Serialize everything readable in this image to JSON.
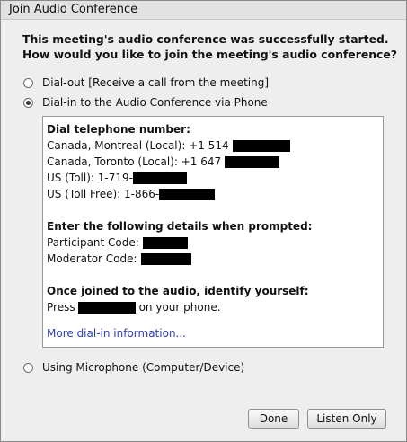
{
  "window": {
    "title": "Join Audio Conference"
  },
  "heading": {
    "line1": "This meeting's audio conference was successfully started.",
    "line2": "How would you like to join the meeting's audio conference?"
  },
  "options": [
    {
      "label": "Dial-out [Receive a call from the meeting]",
      "selected": false
    },
    {
      "label": "Dial-in to the Audio Conference via Phone",
      "selected": true
    },
    {
      "label": "Using Microphone (Computer/Device)",
      "selected": false
    }
  ],
  "dialin": {
    "dial_heading": "Dial telephone number:",
    "numbers": [
      {
        "label": "Canada, Montreal (Local): +1 514"
      },
      {
        "label": "Canada, Toronto (Local): +1 647"
      },
      {
        "label": "US (Toll): 1-719-"
      },
      {
        "label": "US (Toll Free): 1-866-"
      }
    ],
    "details_heading": "Enter the following details when prompted:",
    "participant_label": "Participant Code:",
    "moderator_label": "Moderator Code:",
    "identify_heading": "Once joined to the audio, identify yourself:",
    "press_label": "Press",
    "press_suffix": "on your phone.",
    "more_link": "More dial-in information..."
  },
  "buttons": {
    "done": "Done",
    "listen_only": "Listen Only"
  },
  "colors": {
    "link": "#2b3fb8",
    "redaction": "#000000"
  }
}
